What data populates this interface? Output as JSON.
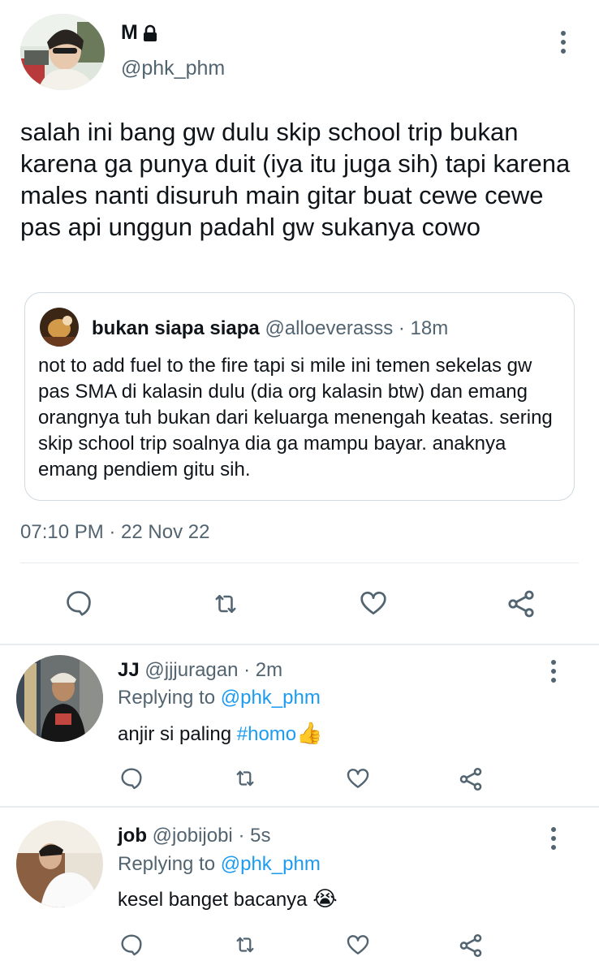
{
  "main_tweet": {
    "name": "M",
    "handle": "@phk_phm",
    "text": "salah ini bang gw dulu skip school trip bukan karena ga punya duit (iya itu juga sih) tapi karena males nanti disuruh main gitar buat cewe cewe pas api unggun padahl gw sukanya cowo",
    "timestamp": "07:10 PM · 22 Nov 22",
    "quote": {
      "name": "bukan siapa siapa",
      "handle": "@alloeverasss",
      "time": "· 18m",
      "text": "not to add fuel to the fire tapi si mile ini temen sekelas gw pas SMA di kalasin dulu (dia org kalasin btw) dan emang orangnya tuh bukan dari keluarga menengah keatas. sering skip school trip soalnya dia ga mampu bayar. anaknya emang pendiem gitu sih."
    }
  },
  "replies": [
    {
      "name": "JJ",
      "handle": "@jjjuragan",
      "time": "· 2m",
      "replying_label": "Replying to",
      "replying_to": "@phk_phm",
      "text_before": "anjir si paling ",
      "hashtag": "#homo",
      "emoji": "👍"
    },
    {
      "name": "job",
      "handle": "@jobijobi",
      "time": "· 5s",
      "replying_label": "Replying to",
      "replying_to": "@phk_phm",
      "text_before": "kesel banget bacanya ",
      "emoji": "😭"
    }
  ],
  "icons": {
    "reply": "reply-icon",
    "retweet": "retweet-icon",
    "like": "like-icon",
    "share": "share-icon",
    "more": "more-icon",
    "lock": "lock-icon"
  },
  "colors": {
    "text": "#0f1419",
    "muted": "#536471",
    "link": "#1d9bf0",
    "divider": "#e6ecf0",
    "emoji_yellow": "#f6c343"
  }
}
